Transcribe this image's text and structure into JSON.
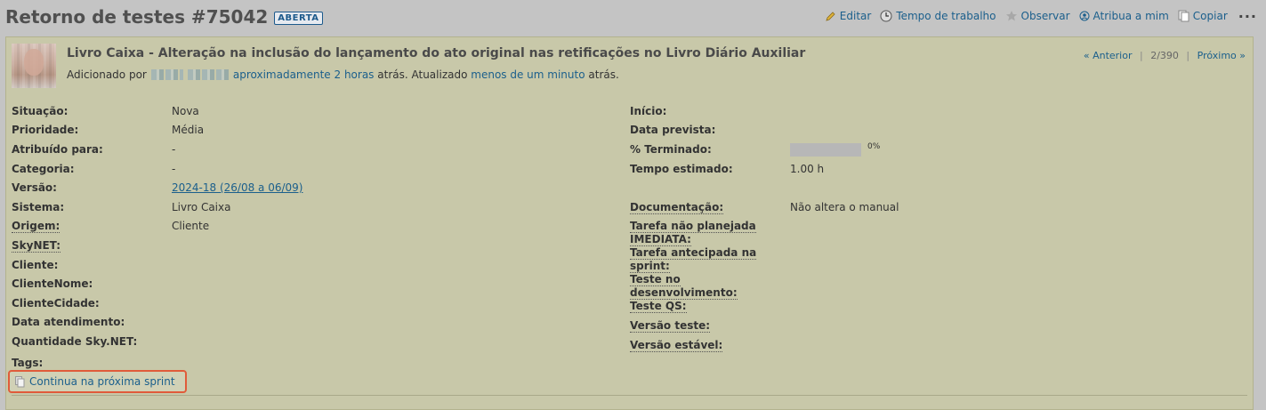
{
  "header": {
    "title": "Retorno de testes #75042",
    "status": "ABERTA"
  },
  "actions": {
    "edit": "Editar",
    "time": "Tempo de trabalho",
    "watch": "Observar",
    "assign": "Atribua a mim",
    "copy": "Copiar",
    "more": "..."
  },
  "issue": {
    "subject": "Livro Caixa - Alteração na inclusão do lançamento do ato original nas retificações no Livro Diário Auxiliar",
    "added_prefix": "Adicionado por",
    "added_time": "aproximadamente 2 horas",
    "added_suffix": "atrás. Atualizado",
    "updated_time": "menos de um minuto",
    "updated_suffix": "atrás."
  },
  "nav": {
    "previous": "« Anterior",
    "sep": "|",
    "position": "2/390",
    "next": "Próximo »"
  },
  "attributes_left": [
    {
      "label": "Situação:",
      "value": "Nova",
      "link": false
    },
    {
      "label": "Prioridade:",
      "value": "Média",
      "link": false
    },
    {
      "label": "Atribuído para:",
      "value": "-",
      "link": false
    },
    {
      "label": "Categoria:",
      "value": "-",
      "link": false
    },
    {
      "label": "Versão:",
      "value": "2024-18 (26/08 a 06/09)",
      "link": true
    },
    {
      "label": "Sistema:",
      "value": "Livro Caixa",
      "link": false
    },
    {
      "label": "Origem:",
      "value": "Cliente",
      "link": false
    },
    {
      "label": "SkyNET:",
      "value": "",
      "link": false
    },
    {
      "label": "Cliente:",
      "value": "",
      "link": false
    },
    {
      "label": "ClienteNome:",
      "value": "",
      "link": false
    },
    {
      "label": "ClienteCidade:",
      "value": "",
      "link": false
    },
    {
      "label": "Data atendimento:",
      "value": "",
      "link": false
    },
    {
      "label": "Quantidade Sky.NET:",
      "value": "",
      "link": false
    }
  ],
  "attributes_right": [
    {
      "label": "Início:",
      "value": ""
    },
    {
      "label": "Data prevista:",
      "value": ""
    },
    {
      "label": "% Terminado:",
      "value": "0%",
      "progress": 0
    },
    {
      "label": "Tempo estimado:",
      "value": "1.00 h"
    },
    {
      "label": "Documentação:",
      "value": "Não altera o manual"
    },
    {
      "label": "Tarefa não planejada IMEDIATA:",
      "value": ""
    },
    {
      "label": "Tarefa antecipada na sprint:",
      "value": ""
    },
    {
      "label": "Teste no desenvolvimento:",
      "value": ""
    },
    {
      "label": "Teste QS:",
      "value": ""
    },
    {
      "label": "Versão teste:",
      "value": ""
    },
    {
      "label": "Versão estável:",
      "value": ""
    }
  ],
  "tags": {
    "label": "Tags:",
    "item": "Continua na próxima sprint"
  }
}
